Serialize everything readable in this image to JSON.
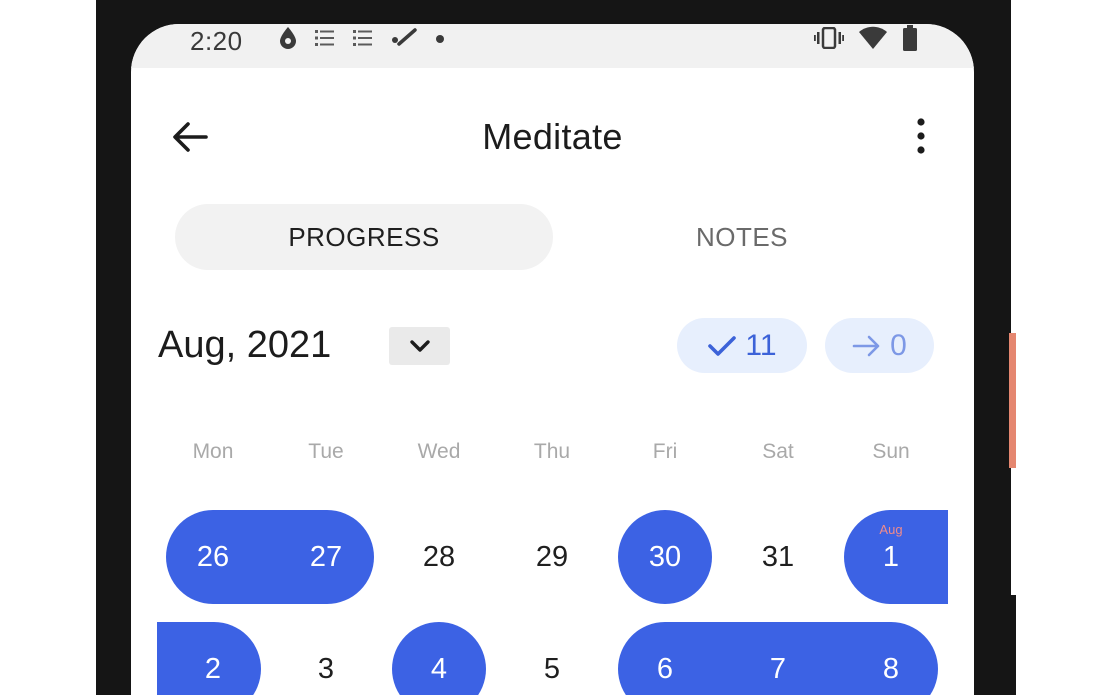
{
  "status_bar": {
    "time": "2:20",
    "left_icons": [
      "drop-icon",
      "list-icon",
      "list-icon",
      "pen-check-icon",
      "dot-icon"
    ],
    "right_icons": [
      "vibrate-icon",
      "wifi-icon",
      "battery-icon"
    ]
  },
  "app_bar": {
    "title": "Meditate",
    "back_icon": "arrow-back-icon",
    "more_icon": "more-vertical-icon"
  },
  "tabs": [
    {
      "label": "PROGRESS",
      "selected": true
    },
    {
      "label": "NOTES",
      "selected": false
    }
  ],
  "month_header": {
    "label": "Aug, 2021",
    "dropdown_icon": "chevron-down-icon",
    "done_count": "11",
    "skipped_count": "0"
  },
  "weekdays": [
    "Mon",
    "Tue",
    "Wed",
    "Thu",
    "Fri",
    "Sat",
    "Sun"
  ],
  "calendar": {
    "rows": [
      {
        "days": [
          {
            "label": "26",
            "done": true
          },
          {
            "label": "27",
            "done": true
          },
          {
            "label": "28",
            "done": false
          },
          {
            "label": "29",
            "done": false
          },
          {
            "label": "30",
            "done": true
          },
          {
            "label": "31",
            "done": false
          },
          {
            "label": "1",
            "done": true,
            "month_tag": "Aug"
          }
        ]
      },
      {
        "days": [
          {
            "label": "2",
            "done": true
          },
          {
            "label": "3",
            "done": false
          },
          {
            "label": "4",
            "done": true
          },
          {
            "label": "5",
            "done": false
          },
          {
            "label": "6",
            "done": true
          },
          {
            "label": "7",
            "done": true
          },
          {
            "label": "8",
            "done": true
          }
        ]
      }
    ]
  },
  "colors": {
    "accent": "#3c62e4",
    "pill_bg": "#e7effd",
    "done_text": "#3c62d8",
    "skipped_text": "#7d98e6",
    "month_tag": "#f08b8b",
    "phone_frame": "#151515",
    "side_button": "#e58770"
  }
}
